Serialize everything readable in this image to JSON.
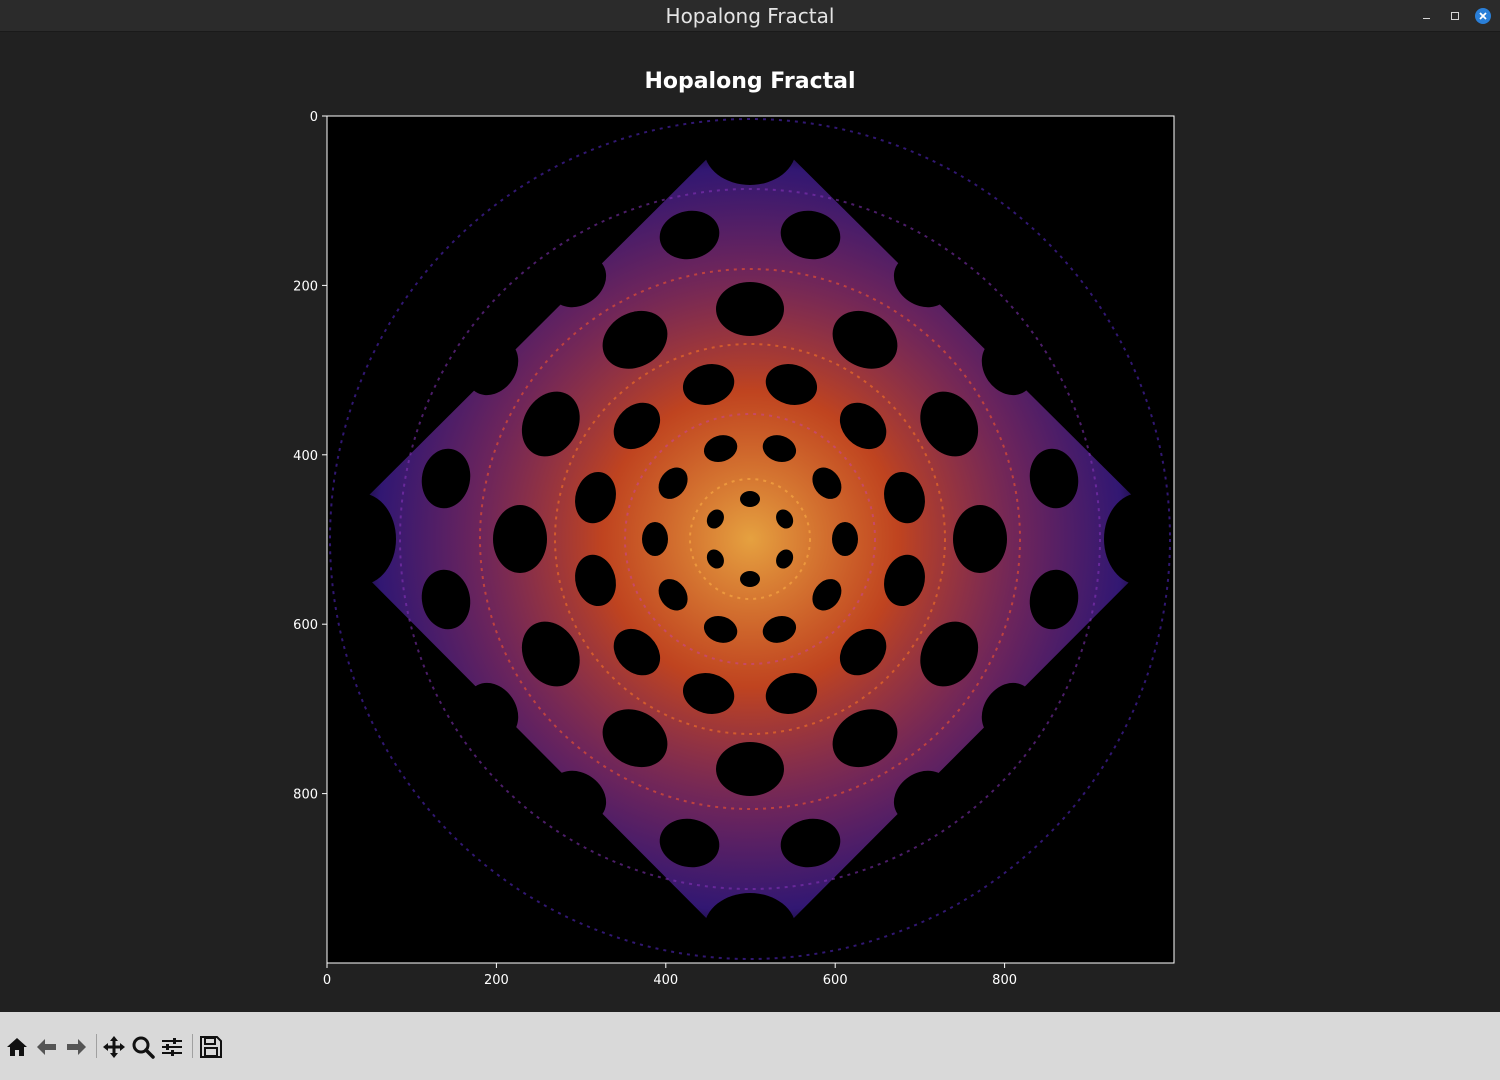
{
  "window": {
    "title": "Hopalong Fractal",
    "controls": [
      "minimize",
      "maximize",
      "close"
    ]
  },
  "colors": {
    "titlebar": "#2b2b2b",
    "figure_background": "#212121",
    "plot_background": "#000000",
    "toolbar_background": "#d9d9d9",
    "colormap": [
      "#000000",
      "#3a1a9a",
      "#6a2cc8",
      "#b03c8c",
      "#ff4a3a",
      "#ff8a20",
      "#ffd84a"
    ]
  },
  "chart_data": {
    "type": "heatmap",
    "title": "Hopalong Fractal",
    "xlabel": "",
    "ylabel": "",
    "xlim": [
      0,
      1000
    ],
    "ylim": [
      1000,
      0
    ],
    "xticks": [
      "0",
      "200",
      "400",
      "600",
      "800"
    ],
    "yticks": [
      "0",
      "200",
      "400",
      "600",
      "800"
    ],
    "grid": false,
    "legend": "none",
    "image_size": [
      1000,
      1000
    ],
    "colormap": "plasma-like (black → purple → orange)"
  },
  "toolbar": {
    "buttons": [
      {
        "name": "home-icon",
        "tooltip": "Reset original view"
      },
      {
        "name": "back-icon",
        "tooltip": "Back to previous view"
      },
      {
        "name": "forward-icon",
        "tooltip": "Forward to next view"
      },
      {
        "name": "pan-icon",
        "tooltip": "Pan axes"
      },
      {
        "name": "zoom-icon",
        "tooltip": "Zoom to rectangle"
      },
      {
        "name": "configure-subplots-icon",
        "tooltip": "Configure subplots"
      },
      {
        "name": "save-icon",
        "tooltip": "Save the figure"
      }
    ]
  }
}
